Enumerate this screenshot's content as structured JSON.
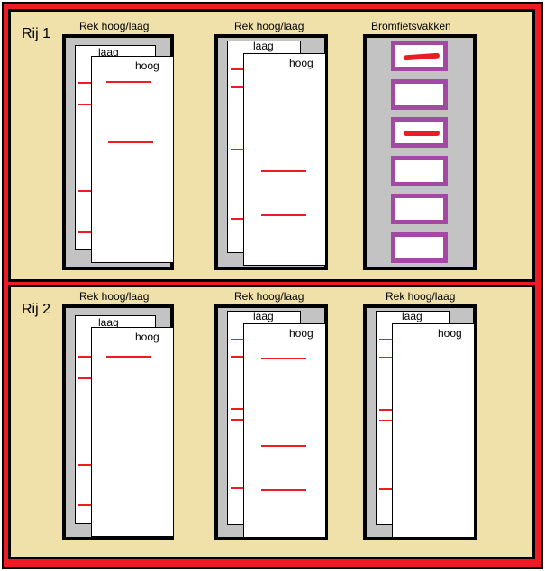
{
  "rows": [
    {
      "label": "Rij 1",
      "units": [
        {
          "kind": "rack",
          "title": "Rek hoog/laag",
          "back_label": "laag",
          "front_label": "hoog"
        },
        {
          "kind": "rack",
          "title": "Rek hoog/laag",
          "back_label": "laag",
          "front_label": "hoog"
        },
        {
          "kind": "moped",
          "title": "Bromfietsvakken",
          "slots": [
            {
              "occupied": true
            },
            {
              "occupied": false
            },
            {
              "occupied": true
            },
            {
              "occupied": false
            },
            {
              "occupied": false
            },
            {
              "occupied": false
            }
          ]
        }
      ]
    },
    {
      "label": "Rij 2",
      "units": [
        {
          "kind": "rack",
          "title": "Rek hoog/laag",
          "back_label": "laag",
          "front_label": "hoog"
        },
        {
          "kind": "rack",
          "title": "Rek hoog/laag",
          "back_label": "laag",
          "front_label": "hoog"
        },
        {
          "kind": "rack",
          "title": "Rek hoog/laag",
          "back_label": "laag",
          "front_label": "hoog"
        }
      ]
    }
  ],
  "colors": {
    "outer_border": "#ed1c24",
    "row_fill": "#f0e1ab",
    "rack_fill": "#c3c3c3",
    "mark": "#ed1c24",
    "moped_slot_border": "#a349a4"
  }
}
